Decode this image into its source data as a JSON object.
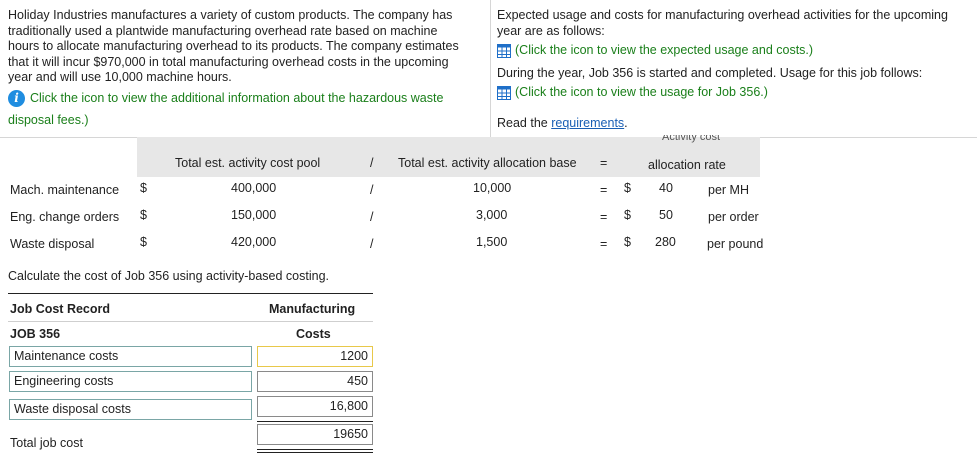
{
  "left_panel": {
    "para": [
      "Holiday Industries manufactures a variety of custom products. The company has",
      "traditionally used a plantwide manufacturing overhead rate based on machine",
      "hours to allocate manufacturing overhead to its products. The company estimates",
      "that it will incur $970,000 in total manufacturing overhead costs in the upcoming",
      "year and will use 10,000 machine hours."
    ],
    "info_link": "Click the icon to view the additional information about the hazardous waste",
    "info_link_2": "disposal fees.)"
  },
  "right_panel": {
    "line1": "Expected usage and costs for manufacturing overhead activities for the upcoming",
    "line2": "year are as follows:",
    "link1": "(Click the icon to view the expected usage and costs.)",
    "line3": "During the year, Job 356 is started and completed. Usage for this job follows:",
    "link2": "(Click the icon to view the usage for Job 356.)",
    "read_prefix": "Read the ",
    "read_link": "requirements",
    "read_suffix": "."
  },
  "table": {
    "hdr_pool": "Total est. activity cost pool",
    "hdr_div": "/",
    "hdr_base": "Total est. activity allocation base",
    "hdr_eq": "=",
    "hdr_rate_top": "Activity cost",
    "hdr_rate": "allocation rate",
    "rows": [
      {
        "label": "Mach. maintenance",
        "dollar": "$",
        "pool": "400,000",
        "div": "/",
        "base": "10,000",
        "eq": "=",
        "dollar2": "$",
        "rate": "40",
        "unit": "per MH"
      },
      {
        "label": "Eng. change orders",
        "dollar": "$",
        "pool": "150,000",
        "div": "/",
        "base": "3,000",
        "eq": "=",
        "dollar2": "$",
        "rate": "50",
        "unit": "per order"
      },
      {
        "label": "Waste disposal",
        "dollar": "$",
        "pool": "420,000",
        "div": "/",
        "base": "1,500",
        "eq": "=",
        "dollar2": "$",
        "rate": "280",
        "unit": "per pound"
      }
    ]
  },
  "instruction": "Calculate the cost of Job 356 using activity-based costing.",
  "job_record": {
    "title": "Job Cost Record",
    "job": "JOB 356",
    "col_top": "Manufacturing",
    "col_bottom": "Costs",
    "rows": [
      {
        "label": "Maintenance costs",
        "value": "1200"
      },
      {
        "label": "Engineering costs",
        "value": "450"
      },
      {
        "label": "Waste disposal costs",
        "value": "16,800"
      }
    ],
    "total_label": "Total job cost",
    "total_value": "19650"
  }
}
